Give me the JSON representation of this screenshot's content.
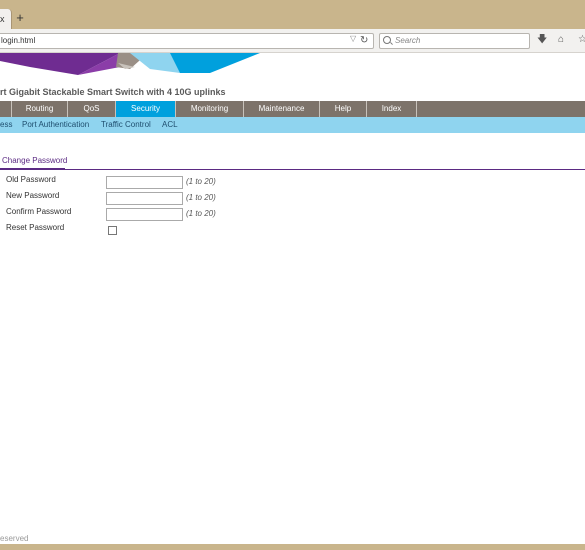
{
  "browser": {
    "new_tab_label": "+",
    "tab_close_label": "x",
    "url": "login.html",
    "search_placeholder": "Search"
  },
  "app": {
    "title": "rt Gigabit Stackable Smart Switch with 4 10G uplinks"
  },
  "main_nav": [
    {
      "label": ""
    },
    {
      "label": "Routing"
    },
    {
      "label": "QoS"
    },
    {
      "label": "Security"
    },
    {
      "label": "Monitoring"
    },
    {
      "label": "Maintenance"
    },
    {
      "label": "Help"
    },
    {
      "label": "Index"
    }
  ],
  "main_nav_active": "Security",
  "sub_nav": [
    {
      "label": "ess"
    },
    {
      "label": "Port Authentication"
    },
    {
      "label": "Traffic Control"
    },
    {
      "label": "ACL"
    }
  ],
  "section": {
    "tab_label": "Change Password"
  },
  "form": {
    "fields": [
      {
        "label": "Old Password",
        "range": "(1 to 20)",
        "value": ""
      },
      {
        "label": "New Password",
        "range": "(1 to 20)",
        "value": ""
      },
      {
        "label": "Confirm Password",
        "range": "(1 to 20)",
        "value": ""
      }
    ],
    "reset_label": "Reset Password",
    "reset_checked": false
  },
  "footer": {
    "text": "eserved"
  },
  "colors": {
    "browser_frame": "#c9b58c",
    "main_nav_bg": "#7d736a",
    "active_nav": "#00a0dd",
    "sub_nav_bg": "#8fd4ef",
    "accent_purple": "#5b2a83"
  }
}
